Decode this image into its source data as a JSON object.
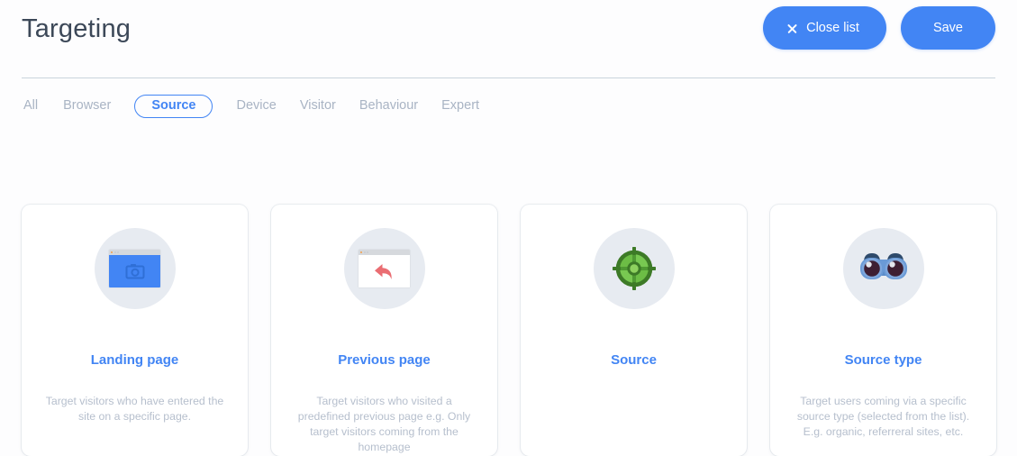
{
  "header": {
    "title": "Targeting",
    "close_button": {
      "label": "Close list",
      "icon": "close-icon"
    },
    "save_button": {
      "label": "Save"
    },
    "accent_color": "#4285f4",
    "title_color": "#3c4858"
  },
  "tabs": [
    {
      "label": "All",
      "active": false
    },
    {
      "label": "Browser",
      "active": false
    },
    {
      "label": "Source",
      "active": true
    },
    {
      "label": "Device",
      "active": false
    },
    {
      "label": "Visitor",
      "active": false
    },
    {
      "label": "Behaviour",
      "active": false
    },
    {
      "label": "Expert",
      "active": false
    }
  ],
  "cards": [
    {
      "title": "Landing page",
      "description": "Target visitors who have entered the site on a specific page.",
      "icon": "browser-window-image-icon"
    },
    {
      "title": "Previous page",
      "description": "Target visitors who visited a predefined previous page e.g. Only target visitors coming from the homepage",
      "icon": "browser-window-back-arrow-icon"
    },
    {
      "title": "Source",
      "description": "",
      "icon": "crosshair-target-icon"
    },
    {
      "title": "Source type",
      "description": "Target users coming via a specific source type (selected from the list). E.g. organic, referreral sites, etc.",
      "icon": "binoculars-icon"
    }
  ]
}
